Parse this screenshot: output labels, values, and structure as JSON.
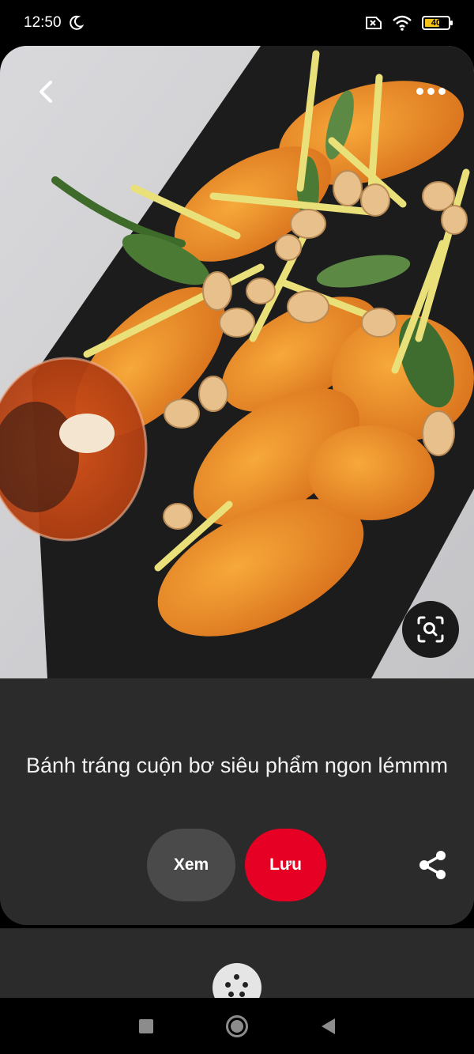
{
  "status_bar": {
    "time": "12:50",
    "battery_level": "40",
    "icons": [
      "moon-icon",
      "no-sim-icon",
      "wifi-icon",
      "battery-icon"
    ]
  },
  "pin": {
    "title": "Bánh tráng cuộn bơ siêu phẩm ngon lémmm",
    "view_label": "Xem",
    "save_label": "Lưu",
    "icons": [
      "back-arrow-icon",
      "more-options-icon",
      "visual-search-icon",
      "share-icon"
    ]
  },
  "colors": {
    "save_button": "#e60023",
    "view_button": "#4a4a4a",
    "card_background": "#2b2b2b",
    "battery_fill": "#f4c31a"
  },
  "nav_bar": {
    "icons": [
      "recents-square-icon",
      "home-circle-icon",
      "back-triangle-icon"
    ]
  }
}
